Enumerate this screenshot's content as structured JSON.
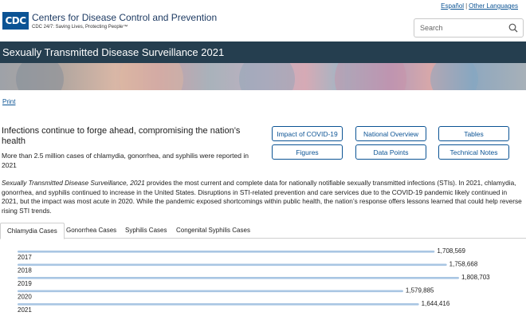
{
  "header": {
    "logo_mark": "CDC",
    "logo_name": "Centers for Disease Control and Prevention",
    "logo_tagline": "CDC 24/7: Saving Lives, Protecting People™",
    "lang_links": [
      "Español",
      "Other Languages"
    ],
    "search_placeholder": "Search"
  },
  "title_bar": {
    "title": "Sexually Transmitted Disease Surveillance 2021"
  },
  "print_link": "Print",
  "lead": {
    "title": "Infections continue to forge ahead, compromising the nation’s health",
    "subtitle": "More than 2.5 million cases of chlamydia, gonorrhea, and syphilis were reported in 2021"
  },
  "nav_buttons": [
    "Impact of COVID-19",
    "National Overview",
    "Tables",
    "Figures",
    "Data Points",
    "Technical Notes"
  ],
  "body": {
    "italic_lead": "Sexually Transmitted Disease Surveillance, 2021",
    "text": " provides the most current and complete data for nationally notifiable sexually transmitted infections (STIs). In 2021, chlamydia, gonorrhea, and syphilis continued to increase in the United States. Disruptions in STI-related prevention and care services due to the COVID-19 pandemic likely continued in 2021, but the impact was most acute in 2020. While the pandemic exposed shortcomings within public health, the nation’s response offers lessons learned that could help reverse rising STI trends."
  },
  "tabs": [
    "Chlamydia Cases",
    "Gonorrhea Cases",
    "Syphilis Cases",
    "Congenital Syphilis Cases"
  ],
  "active_tab": 0,
  "colors": {
    "navy": "#253e4f",
    "link": "#0b5394",
    "bar": "#a9c6e3"
  },
  "chart_data": {
    "type": "bar",
    "orientation": "horizontal",
    "categories": [
      "2017",
      "2018",
      "2019",
      "2020",
      "2021"
    ],
    "values": [
      1708569,
      1758668,
      1808703,
      1579885,
      1644416
    ],
    "value_labels": [
      "1,708,569",
      "1,758,668",
      "1,808,703",
      "1,579,885",
      "1,644,416"
    ],
    "xlim": [
      0,
      1808703
    ]
  }
}
